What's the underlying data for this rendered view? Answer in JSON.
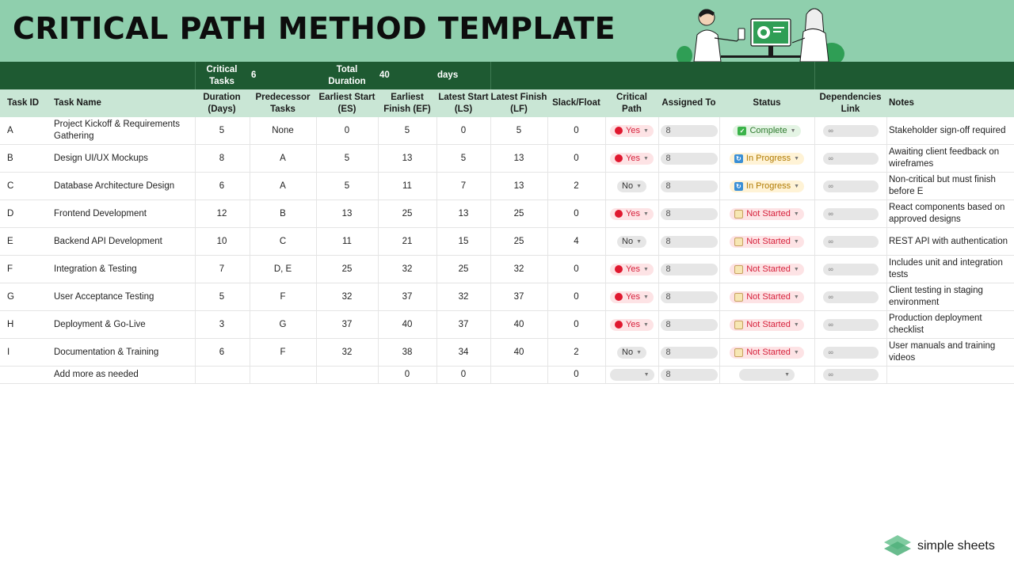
{
  "title": "CRITICAL PATH METHOD TEMPLATE",
  "summary": {
    "critical_tasks_label": "Critical Tasks",
    "critical_tasks_value": "6",
    "total_duration_label": "Total Duration",
    "total_duration_value": "40",
    "days_label": "days"
  },
  "headers": {
    "task_id": "Task ID",
    "task_name": "Task Name",
    "duration": "Duration (Days)",
    "predecessor": "Predecessor Tasks",
    "es": "Earliest Start (ES)",
    "ef": "Earliest Finish (EF)",
    "ls": "Latest Start (LS)",
    "lf": "Latest Finish (LF)",
    "slack": "Slack/Float",
    "critical": "Critical Path",
    "assigned": "Assigned To",
    "status": "Status",
    "deps": "Dependencies Link",
    "notes": "Notes"
  },
  "rows": [
    {
      "id": "A",
      "name": "Project Kickoff & Requirements Gathering",
      "duration": "5",
      "pred": "None",
      "es": "0",
      "ef": "5",
      "ls": "0",
      "lf": "5",
      "slack": "0",
      "critical": "Yes",
      "assigned": "8",
      "status": "Complete",
      "notes": "Stakeholder sign-off required"
    },
    {
      "id": "B",
      "name": "Design UI/UX Mockups",
      "duration": "8",
      "pred": "A",
      "es": "5",
      "ef": "13",
      "ls": "5",
      "lf": "13",
      "slack": "0",
      "critical": "Yes",
      "assigned": "8",
      "status": "In Progress",
      "notes": "Awaiting client feedback on wireframes"
    },
    {
      "id": "C",
      "name": "Database Architecture Design",
      "duration": "6",
      "pred": "A",
      "es": "5",
      "ef": "11",
      "ls": "7",
      "lf": "13",
      "slack": "2",
      "critical": "No",
      "assigned": "8",
      "status": "In Progress",
      "notes": "Non-critical but must finish before E"
    },
    {
      "id": "D",
      "name": "Frontend Development",
      "duration": "12",
      "pred": "B",
      "es": "13",
      "ef": "25",
      "ls": "13",
      "lf": "25",
      "slack": "0",
      "critical": "Yes",
      "assigned": "8",
      "status": "Not Started",
      "notes": "React components based on approved designs"
    },
    {
      "id": "E",
      "name": "Backend API Development",
      "duration": "10",
      "pred": "C",
      "es": "11",
      "ef": "21",
      "ls": "15",
      "lf": "25",
      "slack": "4",
      "critical": "No",
      "assigned": "8",
      "status": "Not Started",
      "notes": "REST API with authentication"
    },
    {
      "id": "F",
      "name": "Integration & Testing",
      "duration": "7",
      "pred": "D, E",
      "es": "25",
      "ef": "32",
      "ls": "25",
      "lf": "32",
      "slack": "0",
      "critical": "Yes",
      "assigned": "8",
      "status": "Not Started",
      "notes": "Includes unit and integration tests"
    },
    {
      "id": "G",
      "name": "User Acceptance Testing",
      "duration": "5",
      "pred": "F",
      "es": "32",
      "ef": "37",
      "ls": "32",
      "lf": "37",
      "slack": "0",
      "critical": "Yes",
      "assigned": "8",
      "status": "Not Started",
      "notes": "Client testing in staging environment"
    },
    {
      "id": "H",
      "name": "Deployment & Go-Live",
      "duration": "3",
      "pred": "G",
      "es": "37",
      "ef": "40",
      "ls": "37",
      "lf": "40",
      "slack": "0",
      "critical": "Yes",
      "assigned": "8",
      "status": "Not Started",
      "notes": "Production deployment checklist"
    },
    {
      "id": "I",
      "name": "Documentation & Training",
      "duration": "6",
      "pred": "F",
      "es": "32",
      "ef": "38",
      "ls": "34",
      "lf": "40",
      "slack": "2",
      "critical": "No",
      "assigned": "8",
      "status": "Not Started",
      "notes": "User manuals and training videos"
    },
    {
      "id": "",
      "name": "Add more as needed",
      "duration": "",
      "pred": "",
      "es": "",
      "ef": "0",
      "ls": "0",
      "lf": "",
      "slack": "0",
      "critical": "",
      "assigned": "8",
      "status": "",
      "notes": ""
    }
  ],
  "icons": {
    "critical_yes": "red-circle-icon",
    "status_complete": "check-box-icon",
    "status_in_progress": "sync-icon",
    "status_not_started": "memo-icon",
    "assigned": "person-icon",
    "link": "link-icon",
    "dropdown": "chevron-down-icon"
  },
  "colors": {
    "banner": "#8fcfad",
    "summary_bar": "#1e5a32",
    "header_row": "#c9e6d5",
    "critical_yes": "#d6203b",
    "status_complete": "#2e7a2e",
    "status_in_progress": "#b07a00",
    "status_not_started": "#d6203b"
  },
  "brand": "simple sheets"
}
